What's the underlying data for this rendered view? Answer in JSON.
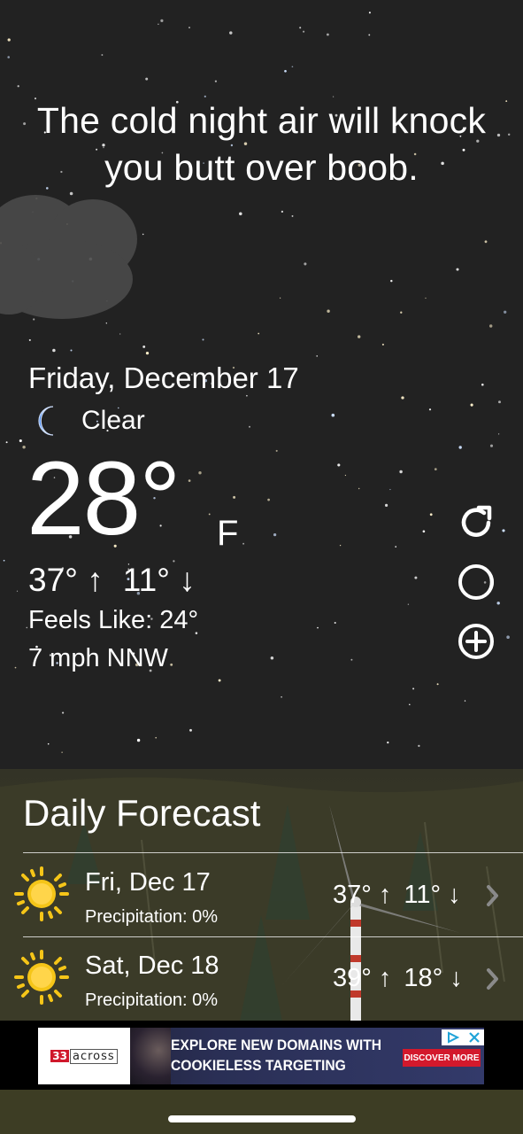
{
  "headline": "The cold night air will knock you butt over boob.",
  "current": {
    "date": "Friday, December 17",
    "condition": "Clear",
    "condition_icon": "crescent-moon-icon",
    "temperature": "28°",
    "unit": "F",
    "high": "37° ↑",
    "low": "11° ↓",
    "feels_like": "Feels Like: 24°",
    "wind": "7 mph NNW"
  },
  "actions": [
    {
      "name": "refresh",
      "icon": "refresh-icon"
    },
    {
      "name": "moon-phase",
      "icon": "moon-phase-icon"
    },
    {
      "name": "add-location",
      "icon": "plus-circle-icon"
    }
  ],
  "forecast": {
    "title": "Daily Forecast",
    "days": [
      {
        "day": "Fri, Dec 17",
        "precipitation": "Precipitation: 0%",
        "high": "37° ↑",
        "low": "11° ↓",
        "icon": "sun-icon"
      },
      {
        "day": "Sat, Dec 18",
        "precipitation": "Precipitation: 0%",
        "high": "39° ↑",
        "low": "18° ↓",
        "icon": "sun-icon"
      }
    ]
  },
  "ad": {
    "logo_number": "33",
    "logo_word": "across",
    "line1": "EXPLORE NEW DOMAINS WITH",
    "line2": "COOKIELESS TARGETING",
    "cta": "DISCOVER MORE"
  },
  "colors": {
    "background": "#222222",
    "moon": "#3a7ee6",
    "sun": "#f5c518",
    "ad_cta": "#d3192c"
  }
}
